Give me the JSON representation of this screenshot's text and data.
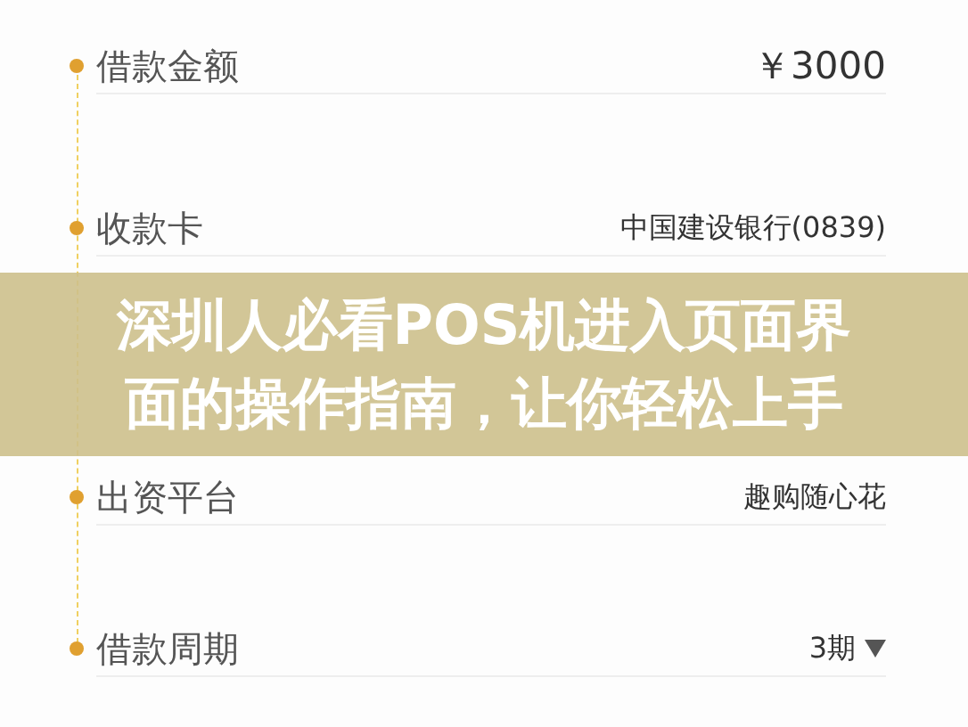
{
  "rows": [
    {
      "kind": "text",
      "label": "借款金额",
      "value": "￥3000"
    },
    {
      "kind": "text",
      "label": "收款卡",
      "value": "中国建设银行(0839)"
    },
    {
      "kind": "text",
      "label": "出资平台",
      "value": "趣购随心花"
    },
    {
      "kind": "dropdown",
      "label": "借款周期",
      "value": "3期"
    }
  ],
  "banner": {
    "lines": [
      "深圳人必看POS机进入页面界",
      "面的操作指南，让你轻松上手"
    ]
  }
}
